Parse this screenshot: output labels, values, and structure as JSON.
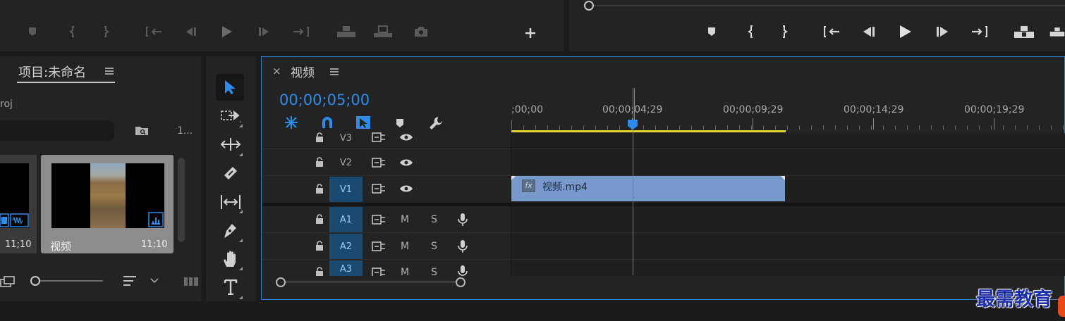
{
  "project": {
    "title": "项目:未命名",
    "path_fragment": "roj",
    "count_fragment": "1...",
    "clips": [
      {
        "name": "",
        "duration": "11;10"
      },
      {
        "name": "视频",
        "duration": "11;10"
      }
    ]
  },
  "timeline": {
    "tab_title": "视频",
    "close_symbol": "×",
    "timecode": "00;00;05;00",
    "ruler_labels": [
      ";00;00",
      "00;00;04;29",
      "00;00;09;29",
      "00;00;14;29",
      "00;00;19;29"
    ],
    "playhead_position": "00;00;05;00",
    "video_tracks": [
      "V3",
      "V2",
      "V1"
    ],
    "audio_tracks": [
      "A1",
      "A2",
      "A3"
    ],
    "mute_label": "M",
    "solo_label": "S",
    "clip": {
      "name": "视频.mp4",
      "fx_label": "fx"
    }
  },
  "watermark": "最需教育",
  "colors": {
    "accent_blue": "#2d8ceb",
    "clip_blue": "#7799cc",
    "track_target": "#184a72",
    "work_area_yellow": "#e3d433"
  }
}
